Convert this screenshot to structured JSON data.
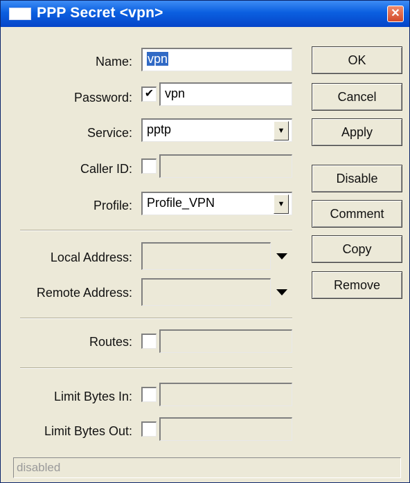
{
  "window": {
    "title": "PPP Secret <vpn>",
    "close_icon": "close-icon"
  },
  "form": {
    "name": {
      "label": "Name:",
      "value": "vpn"
    },
    "password": {
      "label": "Password:",
      "checked": true,
      "check_mark": "✔",
      "value": "vpn"
    },
    "service": {
      "label": "Service:",
      "value": "pptp"
    },
    "caller_id": {
      "label": "Caller ID:",
      "checked": false,
      "value": ""
    },
    "profile": {
      "label": "Profile:",
      "value": "Profile_VPN"
    },
    "local_address": {
      "label": "Local Address:",
      "value": ""
    },
    "remote_address": {
      "label": "Remote Address:",
      "value": ""
    },
    "routes": {
      "label": "Routes:",
      "checked": false,
      "value": ""
    },
    "limit_bytes_in": {
      "label": "Limit Bytes In:",
      "checked": false,
      "value": ""
    },
    "limit_bytes_out": {
      "label": "Limit Bytes Out:",
      "checked": false,
      "value": ""
    }
  },
  "buttons": {
    "ok": "OK",
    "cancel": "Cancel",
    "apply": "Apply",
    "disable": "Disable",
    "comment": "Comment",
    "copy": "Copy",
    "remove": "Remove"
  },
  "status": {
    "text": "disabled"
  },
  "icons": {
    "dropdown": "▼"
  },
  "colors": {
    "titlebar": "#0a5fe0",
    "selection": "#316ac5",
    "dialog_bg": "#ece9d8"
  }
}
